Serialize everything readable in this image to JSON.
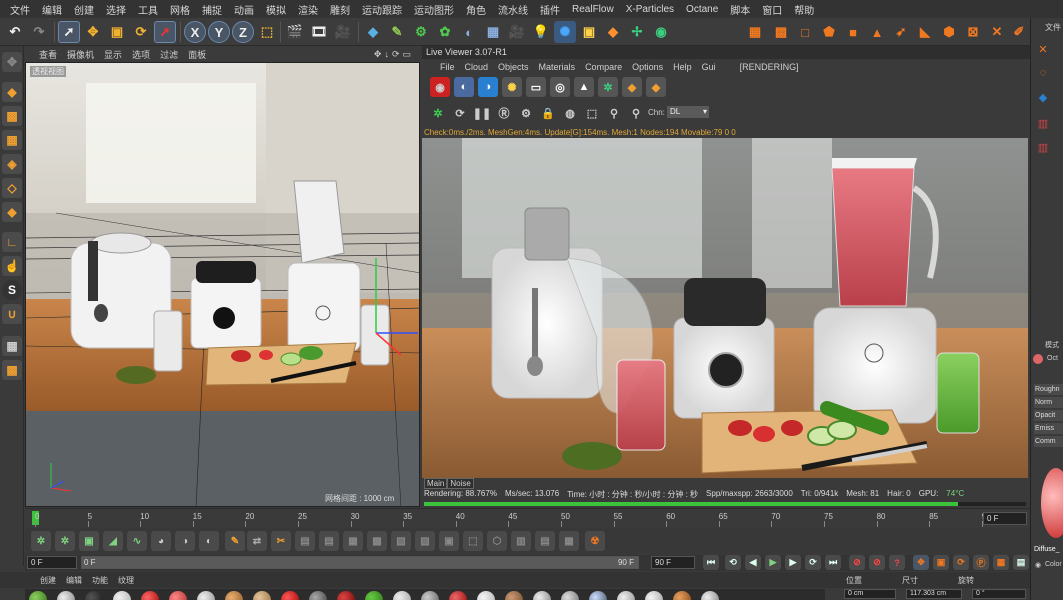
{
  "menubar": {
    "items": [
      "文件",
      "编辑",
      "创建",
      "选择",
      "工具",
      "网格",
      "捕捉",
      "动画",
      "模拟",
      "渲染",
      "雕刻",
      "运动跟踪",
      "运动图形",
      "角色",
      "流水线",
      "插件",
      "RealFlow",
      "X-Particles",
      "Octane",
      "脚本",
      "窗口",
      "帮助"
    ]
  },
  "toolbar": {
    "axis_x": "X",
    "axis_y": "Y",
    "axis_z": "Z"
  },
  "viewport": {
    "menu": [
      "查看",
      "摄像机",
      "显示",
      "选项",
      "过滤",
      "面板"
    ],
    "label": "透视视图",
    "grid_text": "网格间距 : 1000 cm",
    "controls": "✥↓⟳▭"
  },
  "live_viewer": {
    "title": "Live Viewer 3.07-R1",
    "menu": [
      "File",
      "Cloud",
      "Objects",
      "Materials",
      "Compare",
      "Options",
      "Help",
      "Gui"
    ],
    "status": "[RENDERING]",
    "chn_label": "Chn:",
    "chn_value": "DL",
    "check_line": "Check:0ms./2ms. MeshGen:4ms. Update[G]:154ms. Mesh:1 Nodes:194 Movable:79  0 0",
    "tabs": [
      "Main",
      "Noise"
    ],
    "stats": {
      "rendering": "Rendering: 88.767%",
      "ms_sec": "Ms/sec: 13.076",
      "time": "Time: 小时 : 分钟 : 秒/小时 : 分钟 : 秒",
      "spp": "Spp/maxspp: 2663/3000",
      "tri": "Tri: 0/941k",
      "mesh": "Mesh: 81",
      "hair": "Hair: 0",
      "gpu": "GPU:",
      "temp": "74°C"
    },
    "progress": 0.88767
  },
  "timeline": {
    "ticks": [
      "0",
      "5",
      "10",
      "15",
      "20",
      "25",
      "30",
      "35",
      "40",
      "45",
      "50",
      "55",
      "60",
      "65",
      "70",
      "75",
      "80",
      "85",
      "90"
    ],
    "end_field": "0 F"
  },
  "framebar": {
    "start": "0 F",
    "start2": "0 F",
    "end": "90 F",
    "end2": "90 F"
  },
  "bottom_tabs": [
    "创建",
    "编辑",
    "功能",
    "纹理"
  ],
  "coords": {
    "headers": [
      "位置",
      "尺寸",
      "旋转"
    ],
    "pos": "0 cm",
    "size": "117.303 cm",
    "rot": "0 °"
  },
  "right_panel": {
    "top_label": "文件",
    "mode_label": "模式",
    "material_name": "Oct",
    "tabs": [
      "Roughn",
      "Norm",
      "Opacit",
      "Emiss",
      "Comm"
    ],
    "diffuse_label": "Diffuse_",
    "color_label": "Color"
  },
  "colors": {
    "accent_orange": "#f07820",
    "progress_green": "#3cc23c",
    "check_text": "#e0a838"
  }
}
